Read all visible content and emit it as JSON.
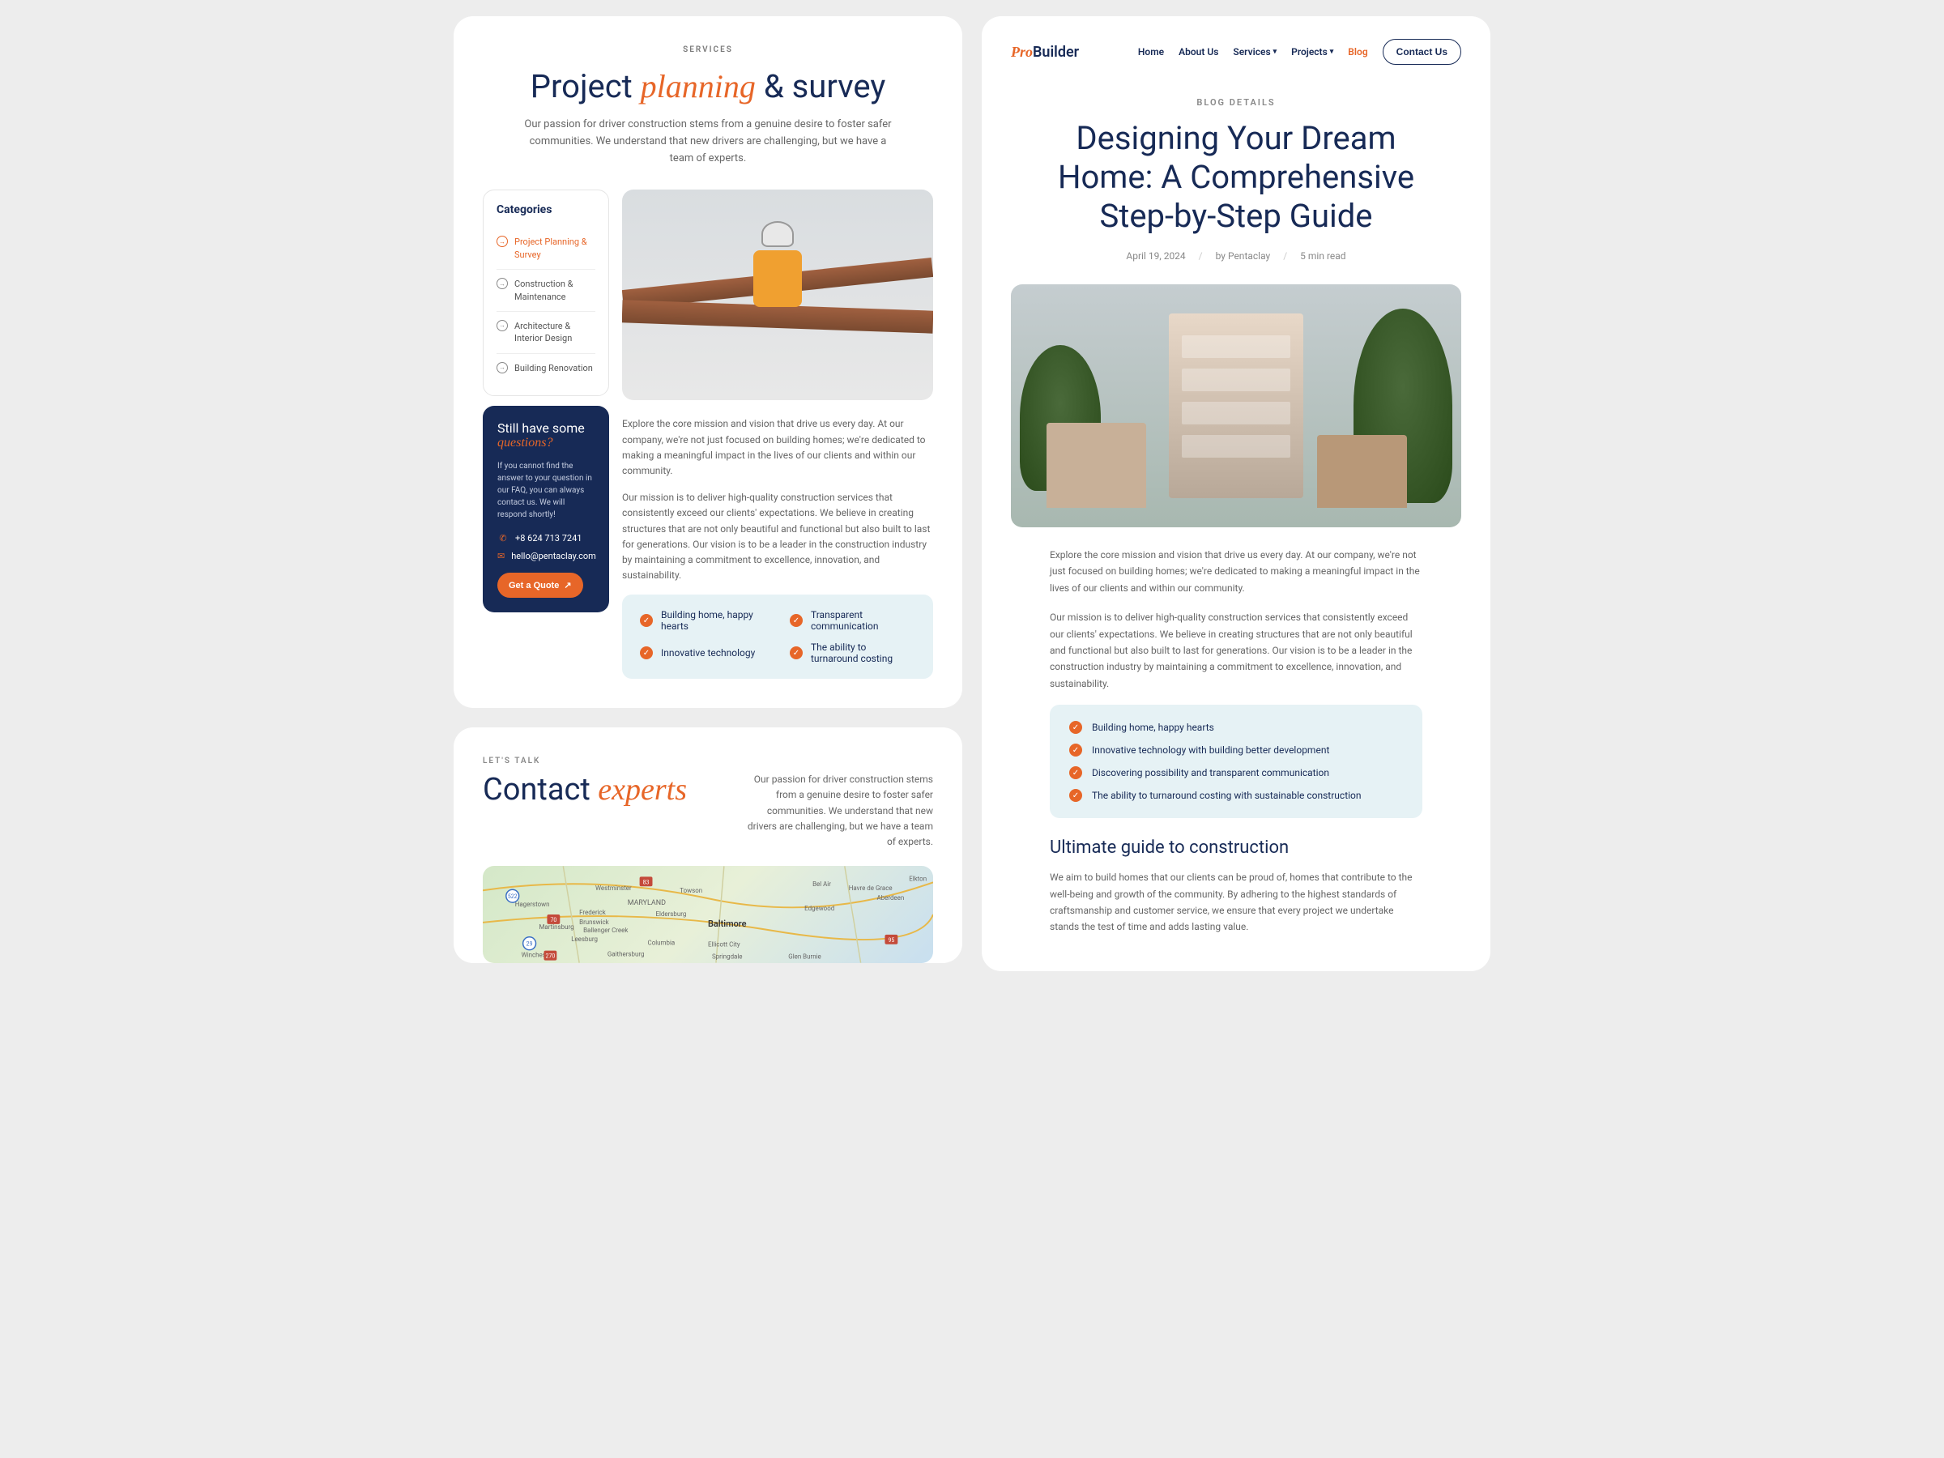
{
  "services": {
    "eyebrow": "SERVICES",
    "title_pre": "Project ",
    "title_italic": "planning",
    "title_post": " & survey",
    "desc": "Our passion for driver construction stems from a genuine desire to foster safer communities.  We understand that new drivers are challenging, but we have a team of experts.",
    "categories": {
      "title": "Categories",
      "items": [
        "Project Planning & Survey",
        "Construction & Maintenance",
        "Architecture & Interior Design",
        "Building Renovation"
      ]
    },
    "question_box": {
      "line1": "Still have some",
      "line2": "questions?",
      "desc": "If you cannot find the answer to your question in our FAQ, you can always contact us. We will respond shortly!",
      "phone": "+8 624 713 7241",
      "email": "hello@pentaclay.com",
      "cta": "Get a Quote"
    },
    "para1": "Explore the core mission and vision that drive us every day. At our company, we're not just focused on building homes; we're dedicated to making a meaningful impact in the lives of our clients and within our community.",
    "para2": "Our mission is to deliver high-quality construction services that consistently exceed our clients' expectations. We believe in creating structures that are not only beautiful and functional but also built to last for generations. Our vision is to be a leader in the construction industry by maintaining a commitment to excellence, innovation, and sustainability.",
    "features": [
      "Building home, happy hearts",
      "Transparent communication",
      "Innovative technology",
      "The ability to turnaround costing"
    ]
  },
  "contact": {
    "eyebrow": "LET'S TALK",
    "title_pre": "Contact ",
    "title_italic": "experts",
    "desc": "Our passion for driver construction stems from a genuine desire to foster safer communities.  We understand that new drivers are challenging, but we have a team of experts."
  },
  "header": {
    "logo_pre": "Pro",
    "logo_post": "Builder",
    "nav": [
      "Home",
      "About Us",
      "Services",
      "Projects",
      "Blog"
    ],
    "cta": "Contact Us"
  },
  "blog": {
    "eyebrow": "BLOG DETAILS",
    "title": "Designing Your Dream Home: A Comprehensive Step-by-Step Guide",
    "meta": {
      "date": "April 19, 2024",
      "author": "by Pentaclay",
      "read": "5 min read"
    },
    "para1": "Explore the core mission and vision that drive us every day. At our company, we're not just focused on building homes; we're dedicated to making a meaningful impact in the lives of our clients and within our community.",
    "para2": "Our mission is to deliver high-quality construction services that consistently exceed our clients' expectations. We believe in creating structures that are not only beautiful and functional but also built to last for generations. Our vision is to be a leader in the construction industry by maintaining a commitment to excellence, innovation, and sustainability.",
    "features": [
      "Building home, happy hearts",
      "Innovative technology with building better development",
      "Discovering possibility and transparent communication",
      "The ability to turnaround costing with sustainable construction"
    ],
    "h3": "Ultimate guide to construction",
    "para3": "We aim to build homes that our clients can be proud of, homes that contribute to the well-being and growth of the community. By adhering to the highest standards of craftsmanship and customer service, we ensure that every project we undertake stands the test of time and adds lasting value."
  }
}
